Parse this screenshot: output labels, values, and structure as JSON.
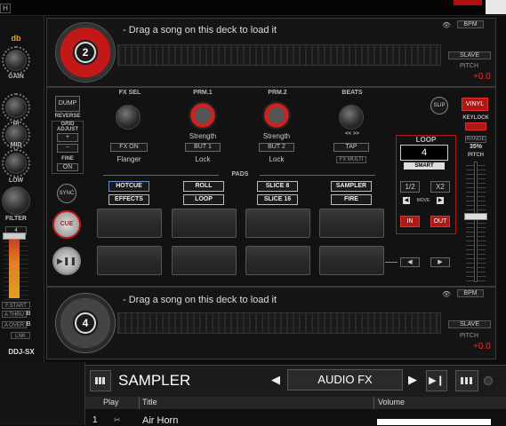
{
  "app": {
    "top_left_label": "H",
    "brand": "DDJ-SX"
  },
  "left": {
    "unit_label": "db",
    "knobs": [
      "GAIN",
      "HI",
      "MID",
      "LOW"
    ],
    "filter_label": "FILTER",
    "fader_value": "4",
    "xfader_start": "F.START",
    "a_thru": "A THRU",
    "a_over": "A OVER",
    "b_label": "B",
    "lnk": "LNK"
  },
  "deck_top": {
    "number": "2",
    "message": "- Drag a song on this deck to load it",
    "bpm_label": "BPM",
    "slave_label": "SLAVE",
    "pitch_label": "PITCH",
    "pitch_value": "+0.0"
  },
  "deck_bottom": {
    "number": "4",
    "message": "- Drag a song on this deck to load it",
    "bpm_label": "BPM",
    "slave_label": "SLAVE",
    "pitch_label": "PITCH",
    "pitch_value": "+0.0"
  },
  "controls": {
    "dump": "DUMP",
    "reverse": "REVERSE",
    "grid_adjust": "GRID ADJUST",
    "fine": "FINE",
    "on": "ON",
    "sync": "SYNC",
    "cue": "CUE",
    "slip": "SLIP",
    "vinyl": "VINYL",
    "keylock": "KEYLOCK",
    "range": "RANGE",
    "range_value": "35%",
    "pitch": "PITCH"
  },
  "fx": {
    "fx_sel": "FX SEL",
    "prm1": "PRM.1",
    "prm2": "PRM.2",
    "beats": "BEATS",
    "strength1": "Strength",
    "strength2": "Strength",
    "fx_on": "FX ON",
    "but1": "BUT 1",
    "but2": "BUT 2",
    "tap": "TAP",
    "flanger": "Flanger",
    "lock1": "Lock",
    "lock2": "Lock",
    "beat_arrows": "<<  >>",
    "fx_multi": "FX MULTI"
  },
  "pads": {
    "title": "PADS",
    "row1": [
      "HOTCUE",
      "ROLL",
      "SLICE 8",
      "SAMPLER"
    ],
    "row2": [
      "EFFECTS",
      "LOOP",
      "SLICE 16",
      "FIRE"
    ]
  },
  "loop": {
    "title": "LOOP",
    "value": "4",
    "smart": "SMART",
    "half": "1/2",
    "double": "X2",
    "move": "MOVE",
    "in": "IN",
    "out": "OUT"
  },
  "sampler": {
    "title": "SAMPLER",
    "mode": "AUDIO FX",
    "col_play": "Play",
    "col_title": "Title",
    "col_volume": "Volume",
    "row_index": "1",
    "row_title": "Air Horn"
  },
  "colors": {
    "accent_red": "#e03030",
    "pad_blue": "#6b8fd6",
    "label_orange": "#f0a020"
  }
}
